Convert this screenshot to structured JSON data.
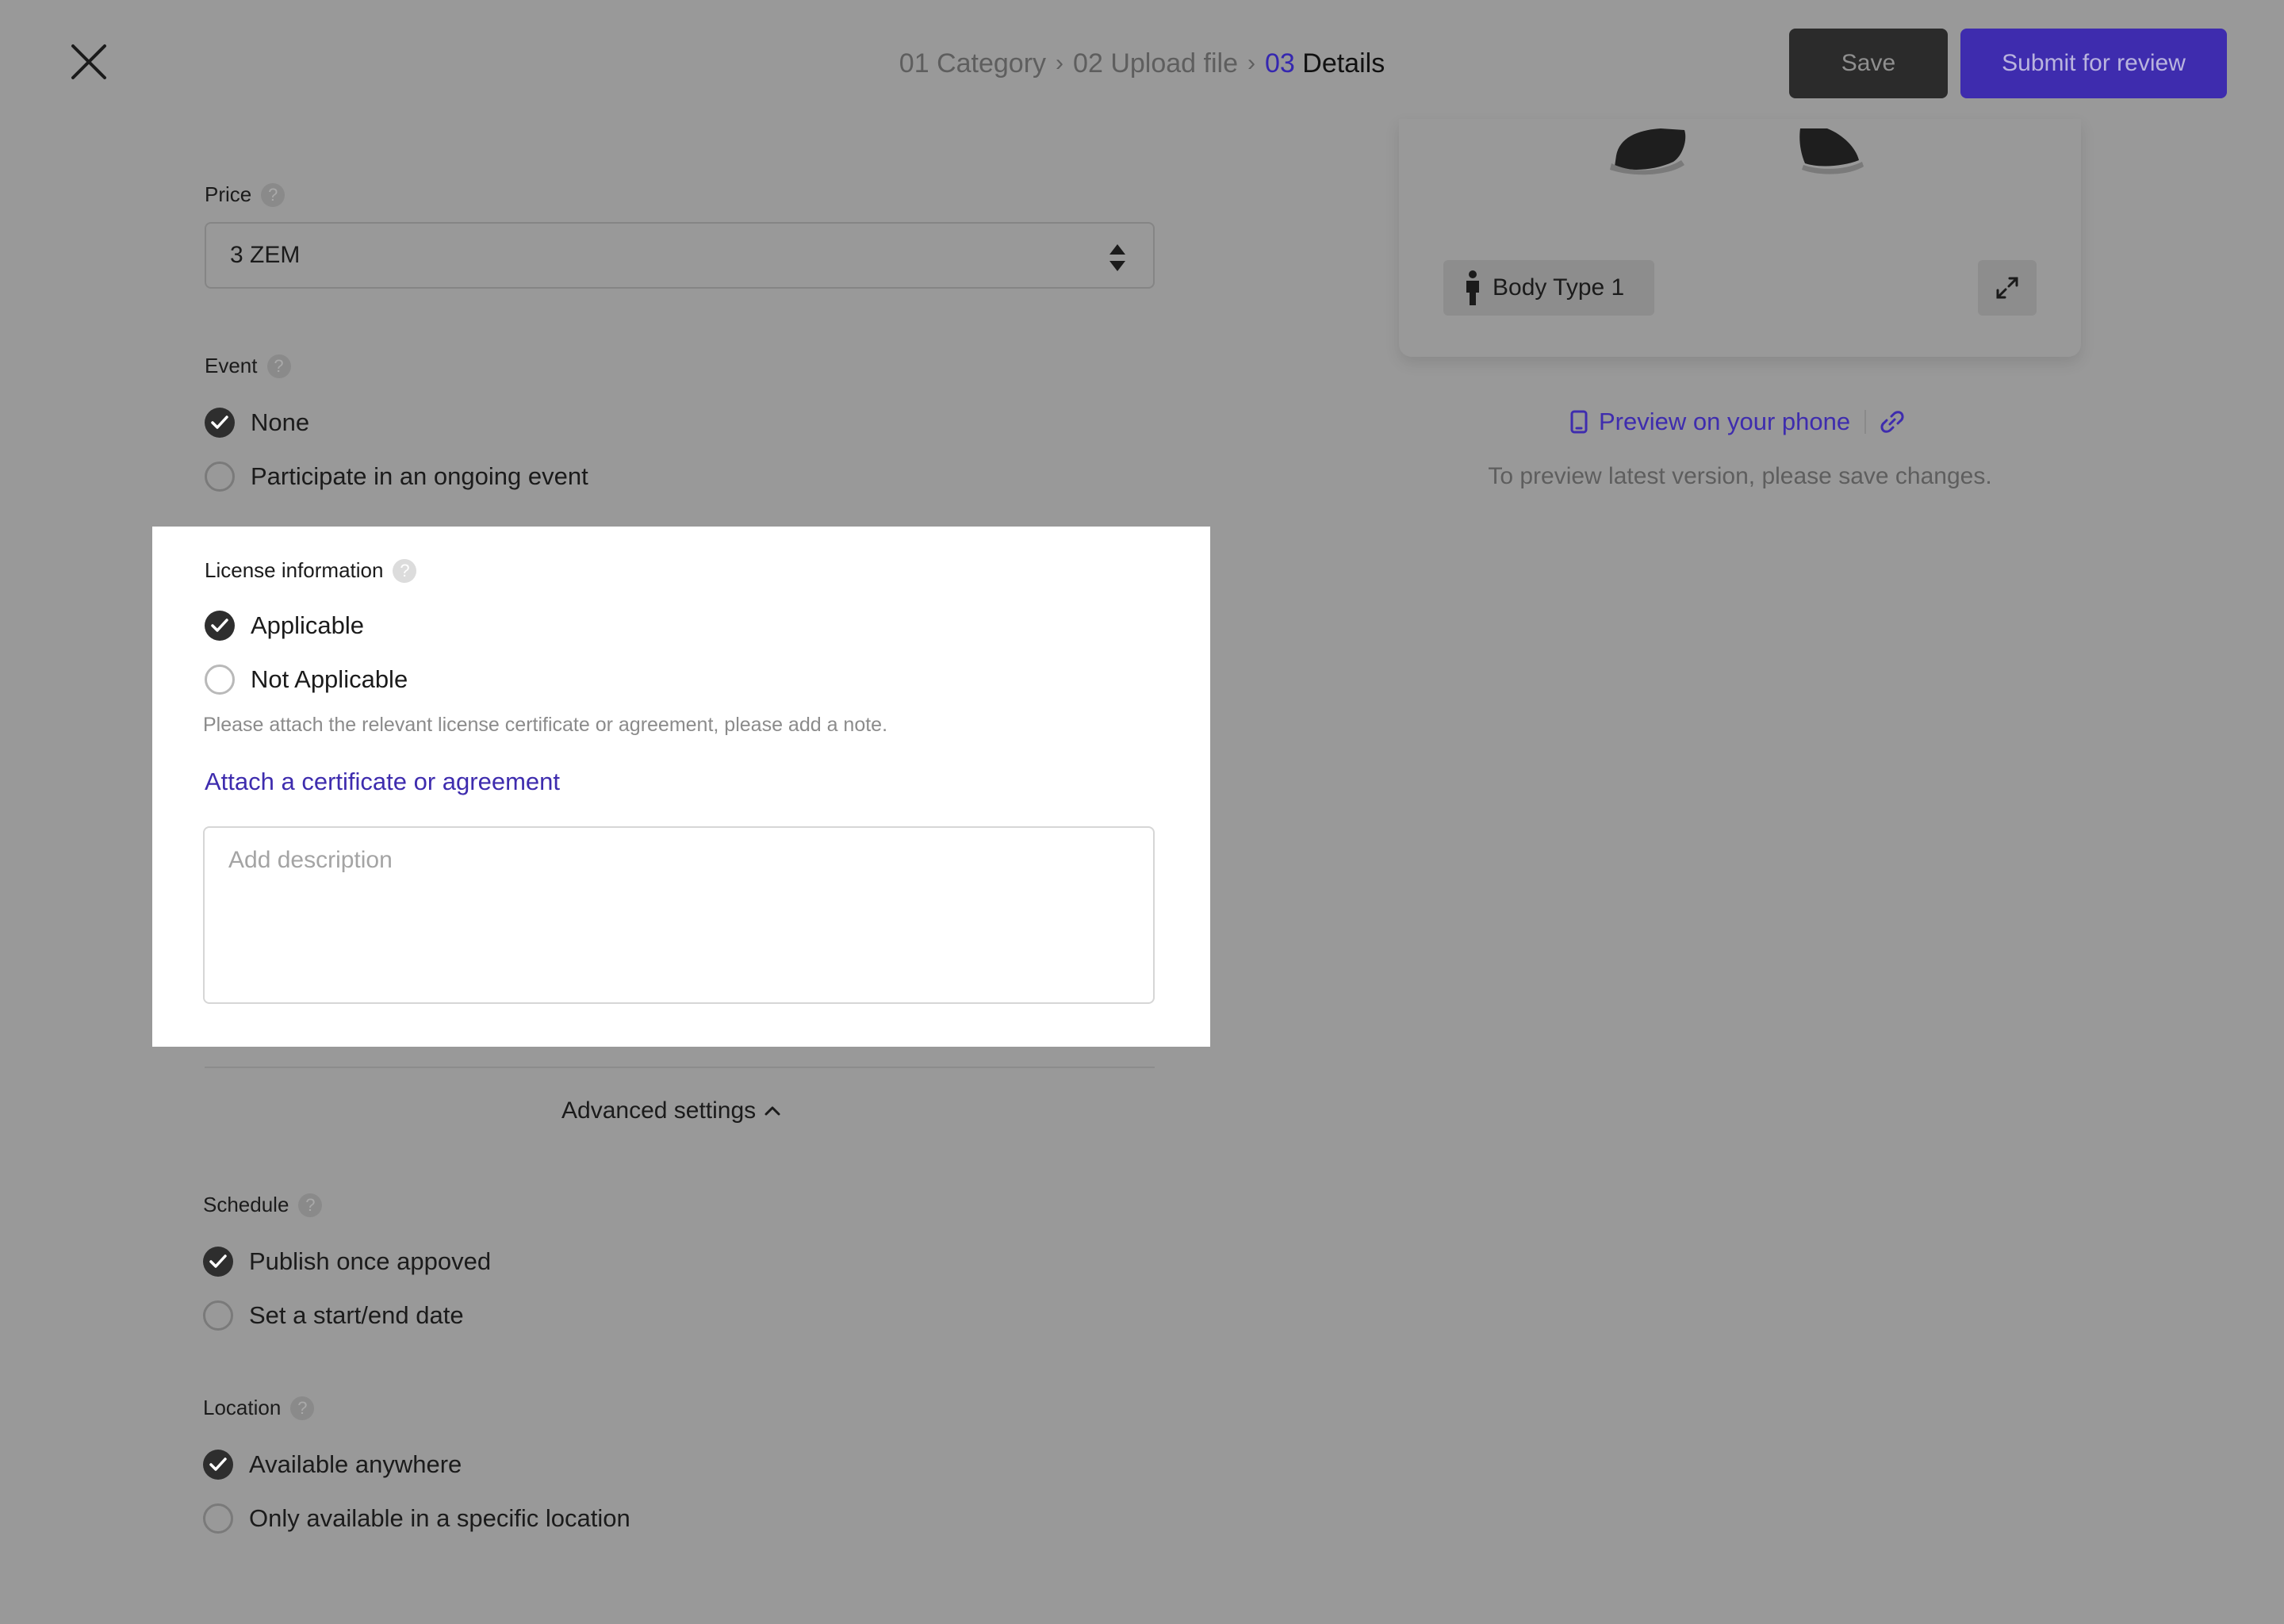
{
  "header": {
    "steps": [
      {
        "num": "01",
        "label": "Category",
        "active": false
      },
      {
        "num": "02",
        "label": "Upload file",
        "active": false
      },
      {
        "num": "03",
        "label": "Details",
        "active": true
      }
    ],
    "save_label": "Save",
    "submit_label": "Submit for review",
    "close_icon": "close-icon"
  },
  "price": {
    "label": "Price",
    "value": "3 ZEM"
  },
  "event": {
    "label": "Event",
    "options": [
      {
        "label": "None",
        "checked": true
      },
      {
        "label": "Participate in an ongoing event",
        "checked": false
      }
    ]
  },
  "license": {
    "label": "License information",
    "options": [
      {
        "label": "Applicable",
        "checked": true
      },
      {
        "label": "Not Applicable",
        "checked": false
      }
    ],
    "hint": "Please attach the relevant license certificate or agreement, please add a note.",
    "attach_link": "Attach a certificate or agreement",
    "description_placeholder": "Add description"
  },
  "advanced": {
    "label": "Advanced settings",
    "expanded": true
  },
  "schedule": {
    "label": "Schedule",
    "options": [
      {
        "label": "Publish once appoved",
        "checked": true
      },
      {
        "label": "Set a start/end date",
        "checked": false
      }
    ]
  },
  "location": {
    "label": "Location",
    "options": [
      {
        "label": "Available anywhere",
        "checked": true
      },
      {
        "label": "Only available in a specific location",
        "checked": false
      }
    ]
  },
  "preview": {
    "body_type": "Body Type 1",
    "phone_link": "Preview on your phone",
    "note": "To preview latest version, please save changes."
  },
  "colors": {
    "accent": "#3e2cae",
    "overlay": "#999999",
    "panel": "#ffffff",
    "dark_button": "#2b2b2b"
  }
}
